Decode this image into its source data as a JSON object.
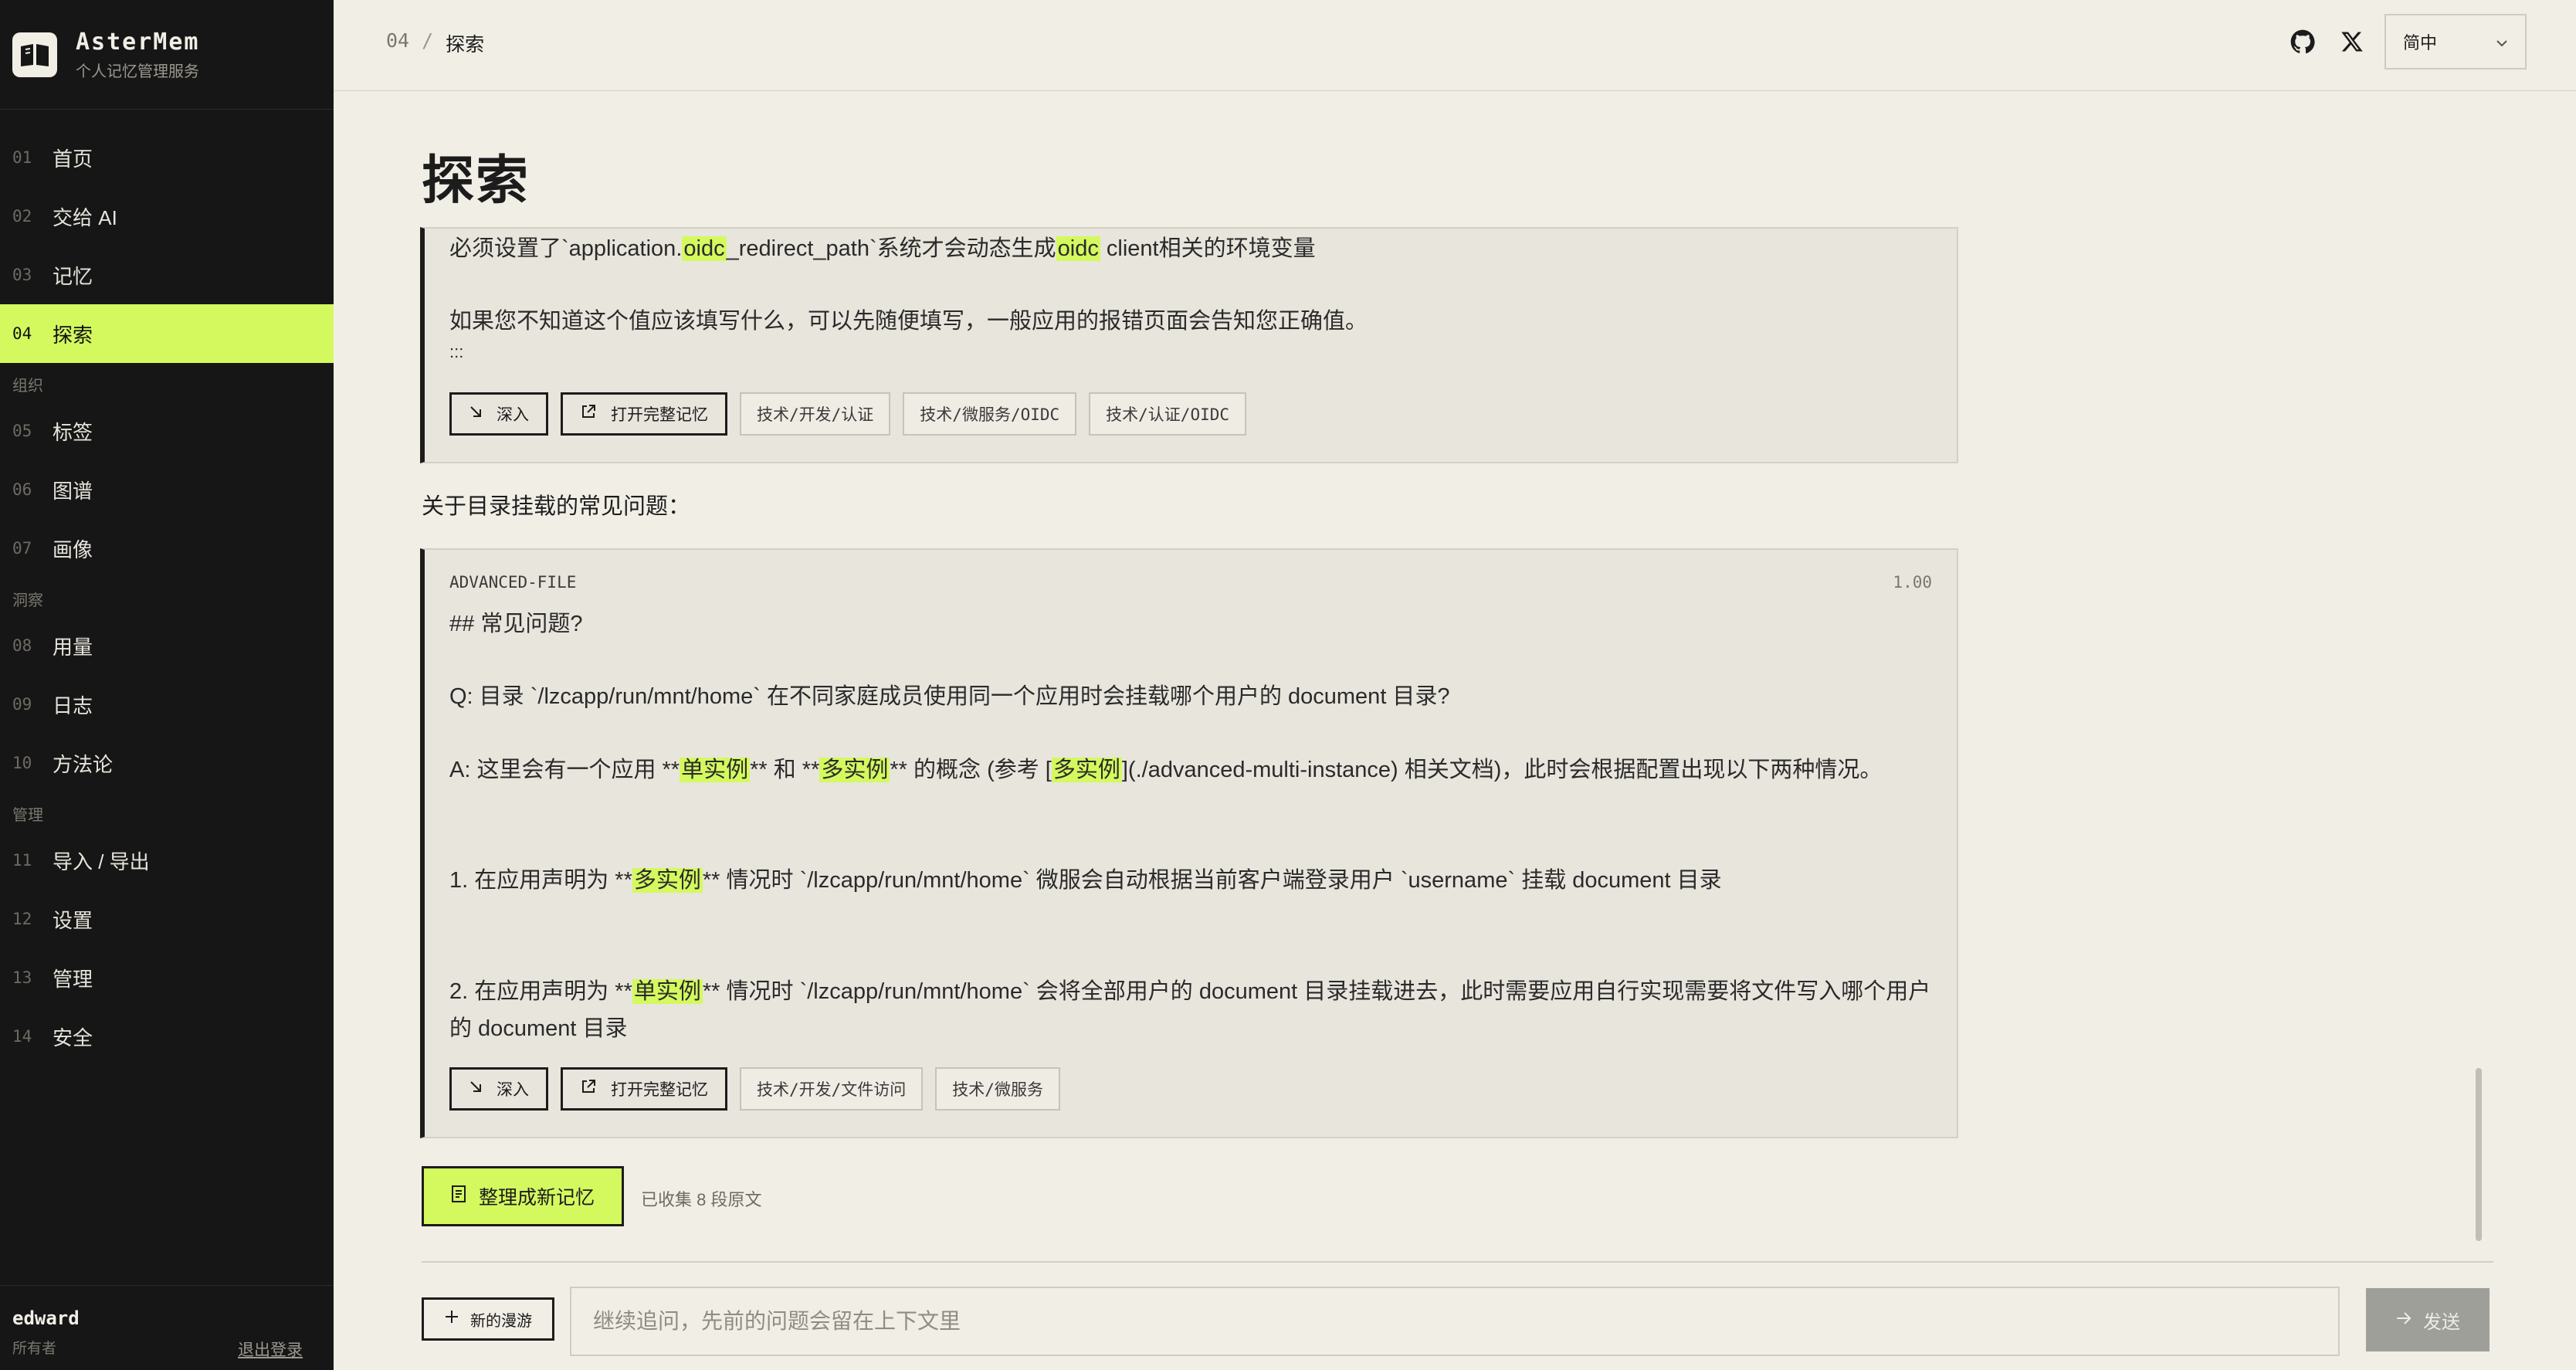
{
  "brand": {
    "name": "AsterMem",
    "subtitle": "个人记忆管理服务"
  },
  "sidebar": {
    "items": [
      {
        "num": "01",
        "label": "首页"
      },
      {
        "num": "02",
        "label": "交给 AI"
      },
      {
        "num": "03",
        "label": "记忆"
      },
      {
        "num": "04",
        "label": "探索"
      }
    ],
    "group_org": "组织",
    "org_items": [
      {
        "num": "05",
        "label": "标签"
      },
      {
        "num": "06",
        "label": "图谱"
      },
      {
        "num": "07",
        "label": "画像"
      }
    ],
    "group_insight": "洞察",
    "insight_items": [
      {
        "num": "08",
        "label": "用量"
      },
      {
        "num": "09",
        "label": "日志"
      },
      {
        "num": "10",
        "label": "方法论"
      }
    ],
    "group_admin": "管理",
    "admin_items": [
      {
        "num": "11",
        "label": "导入 / 导出"
      },
      {
        "num": "12",
        "label": "设置"
      },
      {
        "num": "13",
        "label": "管理"
      },
      {
        "num": "14",
        "label": "安全"
      }
    ]
  },
  "user": {
    "name": "edward",
    "role": "所有者",
    "logout": "退出登录"
  },
  "header": {
    "crumb_num": "04",
    "crumb_sep": "/",
    "crumb_label": "探索",
    "lang": "简中"
  },
  "page": {
    "title": "探索"
  },
  "card1": {
    "line1_a": "必须设置了`application.",
    "line1_hl1": "oidc",
    "line1_b": "_redirect_path`系统才会动态生成",
    "line1_hl2": "oidc",
    "line1_c": " client相关的环境变量",
    "line2": "如果您不知道这个值应该填写什么，可以先随便填写，一般应用的报错页面会告知您正确值。",
    "line3": ":::",
    "btn_dive": "深入",
    "btn_open": "打开完整记忆",
    "tags": [
      "技术/开发/认证",
      "技术/微服务/OIDC",
      "技术/认证/OIDC"
    ]
  },
  "section_label": "关于目录挂载的常见问题：",
  "card2": {
    "source": "ADVANCED-FILE",
    "score": "1.00",
    "heading": "## 常见问题?",
    "q": "Q: 目录 `/lzcapp/run/mnt/home` 在不同家庭成员使用同一个应用时会挂载哪个用户的 document 目录?",
    "a_1": "A: 这里会有一个应用 **",
    "a_hl1": "单实例",
    "a_2": "** 和 **",
    "a_hl2": "多实例",
    "a_3": "** 的概念 (参考 [",
    "a_hl3": "多实例",
    "a_4": "](./advanced-multi-instance) 相关文档)，此时会根据配置出现以下两种情况。",
    "p1_a": "1. 在应用声明为 **",
    "p1_hl": "多实例",
    "p1_b": "** 情况时 `/lzcapp/run/mnt/home` 微服会自动根据当前客户端登录用户 `username` 挂载 document 目录",
    "p2_a": "2. 在应用声明为 **",
    "p2_hl": "单实例",
    "p2_b": "** 情况时 `/lzcapp/run/mnt/home` 会将全部用户的 document 目录挂载进去，此时需要应用自行实现需要将文件写入哪个用户的 document 目录",
    "btn_dive": "深入",
    "btn_open": "打开完整记忆",
    "tags": [
      "技术/开发/文件访问",
      "技术/微服务"
    ]
  },
  "collect": {
    "label": "整理成新记忆",
    "note": "已收集 8 段原文"
  },
  "composer": {
    "new_tour": "新的漫游",
    "placeholder": "继续追问，先前的问题会留在上下文里",
    "send": "发送"
  },
  "colors": {
    "accent": "#d4f95f",
    "sidebar": "#161616",
    "background": "#f1eee6"
  }
}
